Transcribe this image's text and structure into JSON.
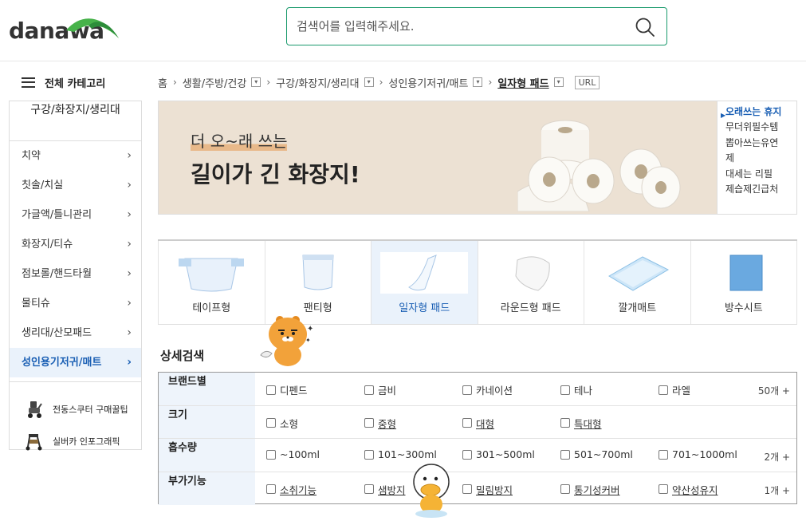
{
  "header": {
    "logo_text": "danawa",
    "search_placeholder": "검색어를 입력해주세요."
  },
  "category_nav": {
    "all_category_label": "전체 카테고리"
  },
  "sidebar": {
    "title": "구강/화장지/생리대",
    "items": [
      {
        "label": "치약"
      },
      {
        "label": "칫솔/치실"
      },
      {
        "label": "가글액/틀니관리"
      },
      {
        "label": "화장지/티슈"
      },
      {
        "label": "점보롤/핸드타월"
      },
      {
        "label": "물티슈"
      },
      {
        "label": "생리대/산모패드"
      },
      {
        "label": "성인용기저귀/매트",
        "active": true
      }
    ],
    "extras": [
      {
        "label": "전동스쿠터 구매꿀팁",
        "icon": "scooter-icon"
      },
      {
        "label": "실버카 인포그래픽",
        "icon": "walker-icon"
      }
    ]
  },
  "breadcrumb": {
    "home": "홈",
    "items": [
      "생활/주방/건강",
      "구강/화장지/생리대",
      "성인용기저귀/매트"
    ],
    "current": "일자형 패드",
    "url_label": "URL"
  },
  "banner": {
    "line1": "더 오~래 쓰는",
    "line2": "길이가 긴 화장지!",
    "accent_color": "#e8b98a",
    "bg_color": "#ece1d3"
  },
  "side_text": {
    "title": "오래쓰는 휴지",
    "lines": [
      "무더위필수템",
      "뽑아쓰는유연",
      "제",
      "대세는 리필",
      "제습제긴급처"
    ]
  },
  "product_types": [
    {
      "label": "테이프형"
    },
    {
      "label": "팬티형"
    },
    {
      "label": "일자형 패드",
      "active": true
    },
    {
      "label": "라운드형 패드"
    },
    {
      "label": "깔개매트"
    },
    {
      "label": "방수시트"
    }
  ],
  "detail_search": {
    "title": "상세검색",
    "rows": [
      {
        "label": "브랜드별",
        "options": [
          "디펜드",
          "금비",
          "카네이션",
          "테나",
          "라엘"
        ],
        "more": "50개 +"
      },
      {
        "label": "크기",
        "options": [
          "소형",
          "중형",
          "대형",
          "특대형"
        ],
        "more": ""
      },
      {
        "label": "흡수량",
        "options": [
          "~100ml",
          "101~300ml",
          "301~500ml",
          "501~700ml",
          "701~1000ml"
        ],
        "more": "2개 +"
      },
      {
        "label": "부가기능",
        "options": [
          "소취기능",
          "샘방지",
          "밀림방지",
          "통기성커버",
          "약산성유지"
        ],
        "more": "1개 +"
      }
    ]
  },
  "colors": {
    "brand_green": "#1a9a6c",
    "active_blue": "#1a5fb4",
    "active_bg": "#eaf2fb"
  }
}
